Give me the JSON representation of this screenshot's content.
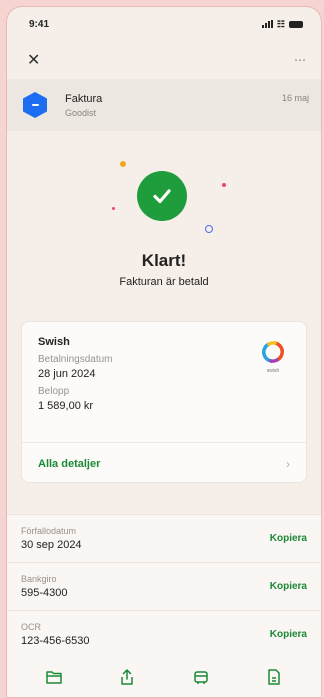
{
  "status_bar": {
    "time": "9:41"
  },
  "top_bar": {
    "close_icon": "close-icon",
    "more_icon": "more-icon"
  },
  "invoice": {
    "title": "Faktura",
    "merchant": "Goodist",
    "date": "16 maj"
  },
  "success": {
    "title": "Klart!",
    "subtitle": "Fakturan är betald"
  },
  "payment_card": {
    "method": "Swish",
    "logo_caption": "swish",
    "payment_date_label": "Betalningsdatum",
    "payment_date": "28 jun 2024",
    "amount_label": "Belopp",
    "amount": "1 589,00 kr",
    "details_link": "Alla detaljer"
  },
  "info_rows": [
    {
      "label": "Förfallodatum",
      "value": "30 sep 2024",
      "action": "Kopiera"
    },
    {
      "label": "Bankgiro",
      "value": "595-4300",
      "action": "Kopiera"
    },
    {
      "label": "OCR",
      "value": "123-456-6530",
      "action": "Kopiera"
    }
  ],
  "tab_bar": {
    "icons": [
      "folder-icon",
      "share-icon",
      "cart-icon",
      "document-icon"
    ]
  },
  "colors": {
    "accent_green": "#1a8a36",
    "check_green": "#1f9d3c",
    "brand_blue": "#1d6df2",
    "background": "#f6efe9",
    "outer_frame": "#f6d4d2"
  }
}
